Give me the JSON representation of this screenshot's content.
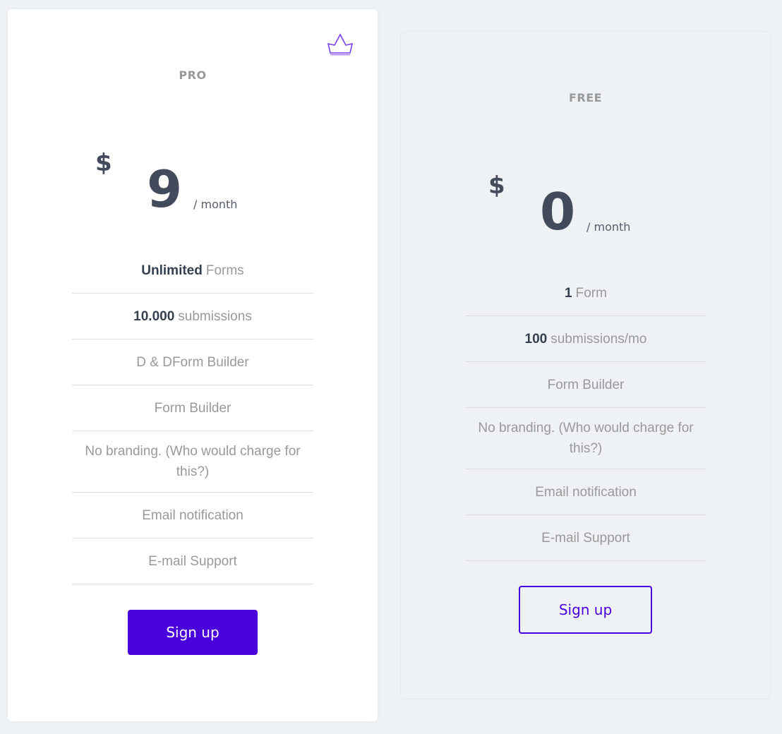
{
  "colors": {
    "accent": "#4a00dd",
    "page_bg": "#eef2f5",
    "text_dark": "#424b5c",
    "text_muted": "#999999"
  },
  "plans": [
    {
      "name": "PRO",
      "badge_icon": "crown-icon",
      "currency": "$",
      "amount": "9",
      "period": "/ month",
      "features": [
        {
          "strong": "Unlimited",
          "text": "Forms"
        },
        {
          "strong": "10.000",
          "text": "submissions"
        },
        {
          "strong": "",
          "text": "D & DForm Builder"
        },
        {
          "strong": "",
          "text": "Form Builder"
        },
        {
          "strong": "",
          "text": "No branding. (Who would charge for this?)"
        },
        {
          "strong": "",
          "text": "Email notification"
        },
        {
          "strong": "",
          "text": "E-mail Support"
        }
      ],
      "cta_label": "Sign up"
    },
    {
      "name": "FREE",
      "currency": "$",
      "amount": "0",
      "period": "/ month",
      "features": [
        {
          "strong": "1",
          "text": "Form"
        },
        {
          "strong": "100",
          "text": "submissions/mo"
        },
        {
          "strong": "",
          "text": "Form Builder"
        },
        {
          "strong": "",
          "text": "No branding. (Who would charge for this?)"
        },
        {
          "strong": "",
          "text": "Email notification"
        },
        {
          "strong": "",
          "text": "E-mail Support"
        }
      ],
      "cta_label": "Sign up"
    }
  ]
}
